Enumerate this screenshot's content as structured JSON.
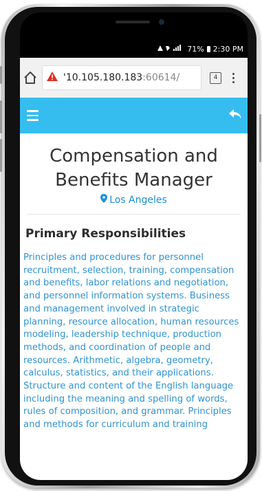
{
  "status_bar": {
    "signal": "☃ ◥ ▐",
    "battery_percent": "71%",
    "time": "2:30 PM"
  },
  "browser": {
    "url_host": "10.105.180.183",
    "url_rest": ":60614/",
    "tab_count": "4"
  },
  "job": {
    "title": "Compensation and Benefits Manager",
    "location": "Los Angeles"
  },
  "section": {
    "heading": "Primary Responsibilities",
    "description": "Principles and procedures for personnel recruitment, selection, training, compensation and benefits, labor relations and negotiation, and personnel information systems. Business and management involved in strategic planning, resource allocation, human resources modeling, leadership technique, production methods, and coordination of people and resources. Arithmetic, algebra, geometry, calculus, statistics, and their applications. Structure and content of the English language including the meaning and spelling of words, rules of composition, and grammar. Principles and methods for curriculum and training"
  },
  "colors": {
    "header_bg": "#36bdf0",
    "link_blue": "#1c8ed6",
    "text_blue": "#2f93d3",
    "warning_red": "#d93025"
  },
  "icons": {
    "home": "home-icon",
    "warning": "warning-icon",
    "tabs": "tabs-icon",
    "menu": "menu-dots-icon",
    "hamburger": "hamburger-icon",
    "back": "reply-arrow-icon",
    "location": "map-marker-icon"
  }
}
